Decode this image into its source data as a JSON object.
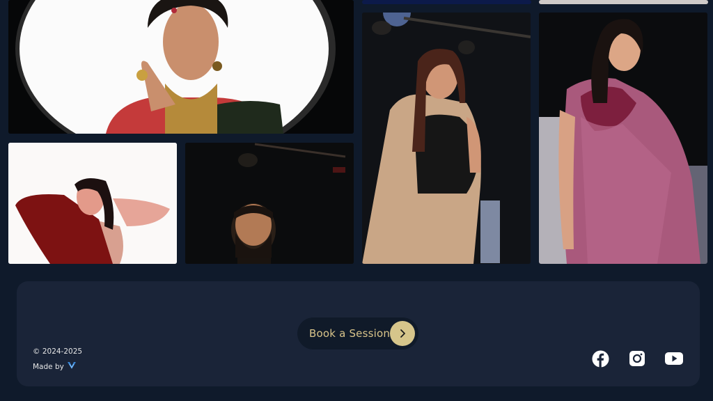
{
  "footer": {
    "cta_label": "Book a Session",
    "copyright": "© 2024-2025",
    "made_by": "Made by"
  },
  "icons": {
    "cta_arrow": "chevron-right-icon",
    "maker_logo": "maker-logo-icon",
    "social": [
      "facebook-icon",
      "instagram-icon",
      "youtube-icon"
    ]
  },
  "colors": {
    "page_bg": "#0f1a2b",
    "card_bg": "#1a2438",
    "accent": "#d6c58b"
  }
}
